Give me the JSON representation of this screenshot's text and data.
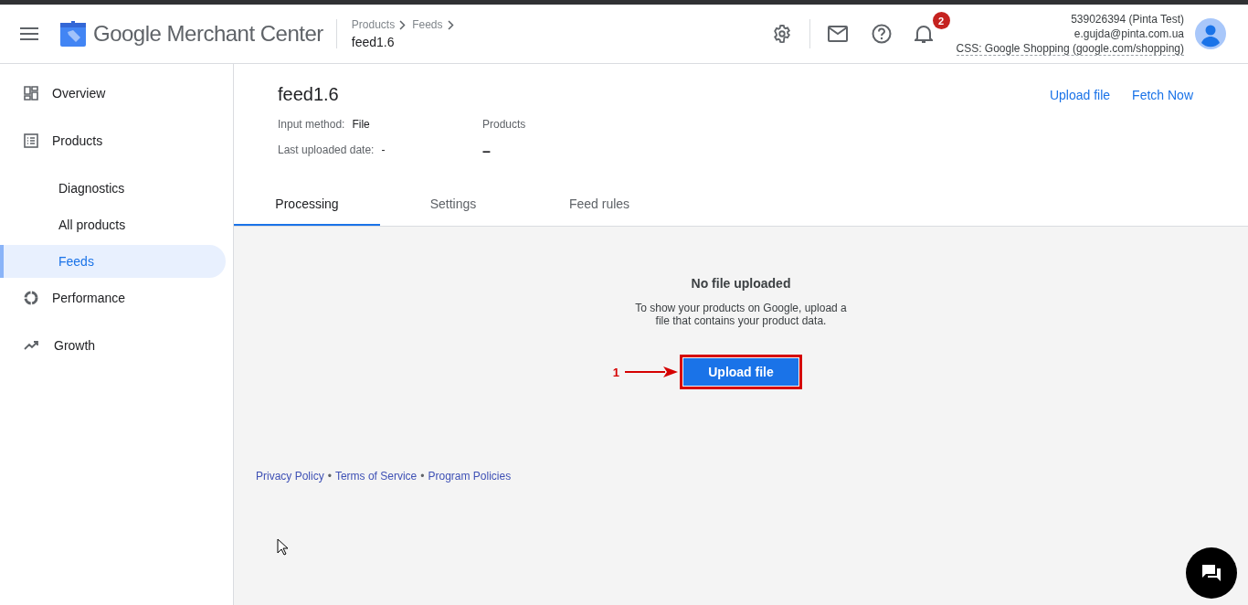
{
  "header": {
    "app_name": "Google Merchant Center",
    "breadcrumbs": [
      {
        "label": "Products"
      },
      {
        "label": "Feeds"
      }
    ],
    "page_title": "feed1.6",
    "notifications_count": "2",
    "account": {
      "id_line": "539026394 (Pinta Test)",
      "email": "e.gujda@pinta.com.ua",
      "css_line": "CSS: Google Shopping (google.com/shopping)"
    }
  },
  "sidebar": {
    "items": [
      {
        "label": "Overview",
        "selected": false
      },
      {
        "label": "Products",
        "selected": false,
        "children": [
          {
            "label": "Diagnostics",
            "selected": false
          },
          {
            "label": "All products",
            "selected": false
          },
          {
            "label": "Feeds",
            "selected": true
          }
        ]
      },
      {
        "label": "Performance",
        "selected": false
      },
      {
        "label": "Growth",
        "selected": false
      }
    ]
  },
  "feed": {
    "title": "feed1.6",
    "actions": [
      "Upload file",
      "Fetch Now"
    ],
    "details": [
      {
        "label": "Input method:",
        "value": "File"
      },
      {
        "label": "Last uploaded date:",
        "value": "-"
      }
    ],
    "products": {
      "label": "Products",
      "value": "–"
    }
  },
  "tabs": [
    {
      "label": "Processing",
      "selected": true
    },
    {
      "label": "Settings",
      "selected": false
    },
    {
      "label": "Feed rules",
      "selected": false
    }
  ],
  "empty_state": {
    "title": "No file uploaded",
    "text": "To show your products on Google, upload a file that contains your product data.",
    "button": "Upload file",
    "highlighted": true,
    "annotation_number": "1"
  },
  "footer": [
    {
      "kind": "link",
      "text": "Privacy Policy"
    },
    {
      "kind": "separator",
      "text": "•"
    },
    {
      "kind": "link",
      "text": "Terms of Service"
    },
    {
      "kind": "separator",
      "text": "•"
    },
    {
      "kind": "link",
      "text": "Program Policies"
    }
  ]
}
